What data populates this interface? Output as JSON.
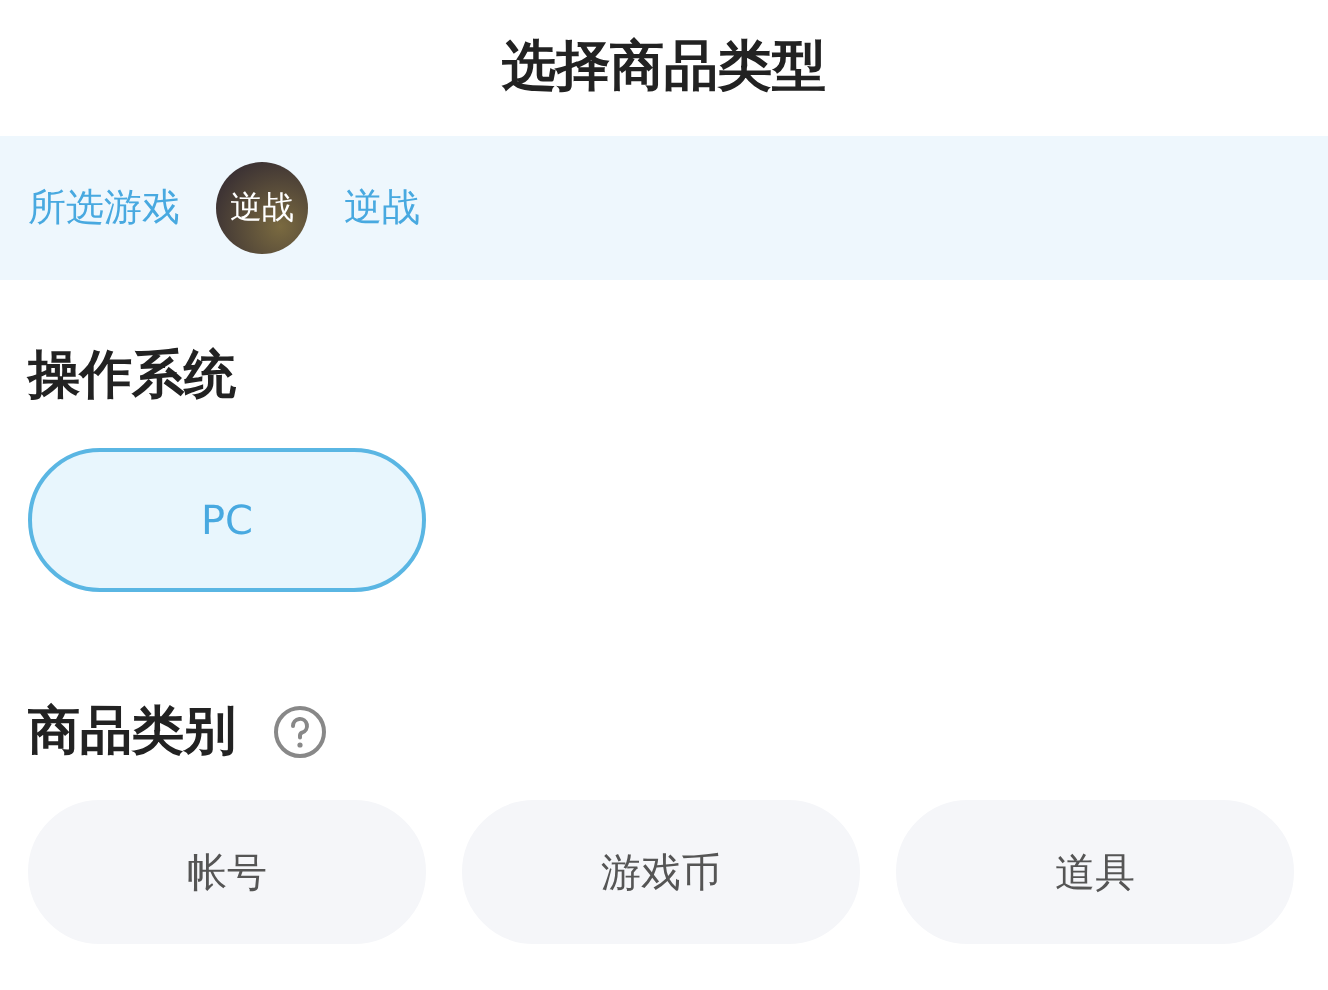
{
  "title": "选择商品类型",
  "selected_game": {
    "label": "所选游戏",
    "icon_text": "逆战",
    "name": "逆战"
  },
  "sections": [
    {
      "title": "操作系统",
      "help": false,
      "options": [
        {
          "label": "PC",
          "selected": true
        }
      ]
    },
    {
      "title": "商品类别",
      "help": true,
      "options": [
        {
          "label": "帐号",
          "selected": false
        },
        {
          "label": "游戏币",
          "selected": false
        },
        {
          "label": "道具",
          "selected": false
        }
      ]
    }
  ]
}
